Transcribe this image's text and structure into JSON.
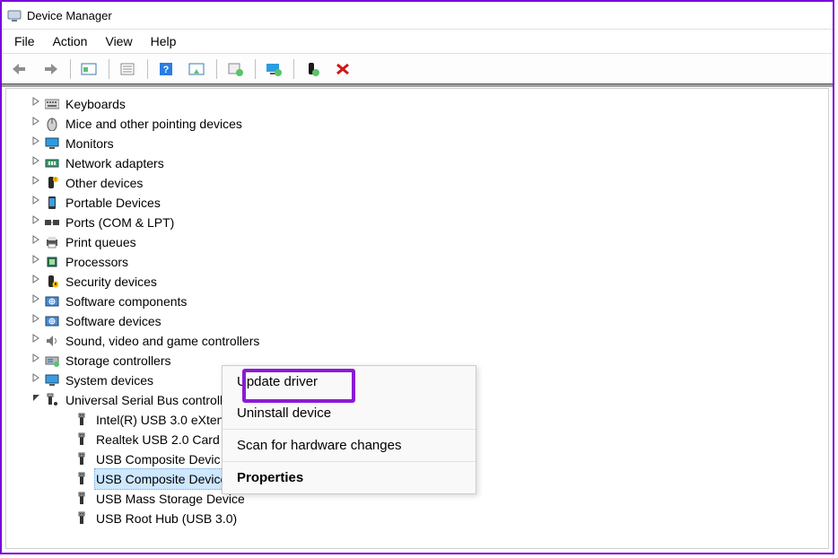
{
  "window": {
    "title": "Device Manager"
  },
  "menu": {
    "items": [
      "File",
      "Action",
      "View",
      "Help"
    ]
  },
  "tree": {
    "nodes": [
      {
        "label": "Keyboards",
        "icon": "keyboard"
      },
      {
        "label": "Mice and other pointing devices",
        "icon": "mouse"
      },
      {
        "label": "Monitors",
        "icon": "monitor"
      },
      {
        "label": "Network adapters",
        "icon": "network"
      },
      {
        "label": "Other devices",
        "icon": "other"
      },
      {
        "label": "Portable Devices",
        "icon": "portable"
      },
      {
        "label": "Ports (COM & LPT)",
        "icon": "port"
      },
      {
        "label": "Print queues",
        "icon": "printer"
      },
      {
        "label": "Processors",
        "icon": "cpu"
      },
      {
        "label": "Security devices",
        "icon": "security"
      },
      {
        "label": "Software components",
        "icon": "software"
      },
      {
        "label": "Software devices",
        "icon": "software"
      },
      {
        "label": "Sound, video and game controllers",
        "icon": "sound"
      },
      {
        "label": "Storage controllers",
        "icon": "storage"
      },
      {
        "label": "System devices",
        "icon": "system"
      },
      {
        "label": "Universal Serial Bus controllers",
        "icon": "usb-ctrl",
        "expanded": true,
        "children": [
          {
            "label": "Intel(R) USB 3.0 eXten",
            "icon": "usb"
          },
          {
            "label": "Realtek USB 2.0 Card",
            "icon": "usb"
          },
          {
            "label": "USB Composite Devic",
            "icon": "usb"
          },
          {
            "label": "USB Composite Device",
            "icon": "usb",
            "selected": true
          },
          {
            "label": "USB Mass Storage Device",
            "icon": "usb"
          },
          {
            "label": "USB Root Hub (USB 3.0)",
            "icon": "usb"
          }
        ]
      }
    ]
  },
  "context_menu": {
    "items": [
      {
        "label": "Update driver",
        "highlighted": true
      },
      {
        "label": "Uninstall device"
      },
      {
        "sep": true
      },
      {
        "label": "Scan for hardware changes"
      },
      {
        "sep": true
      },
      {
        "label": "Properties",
        "bold": true
      }
    ]
  }
}
